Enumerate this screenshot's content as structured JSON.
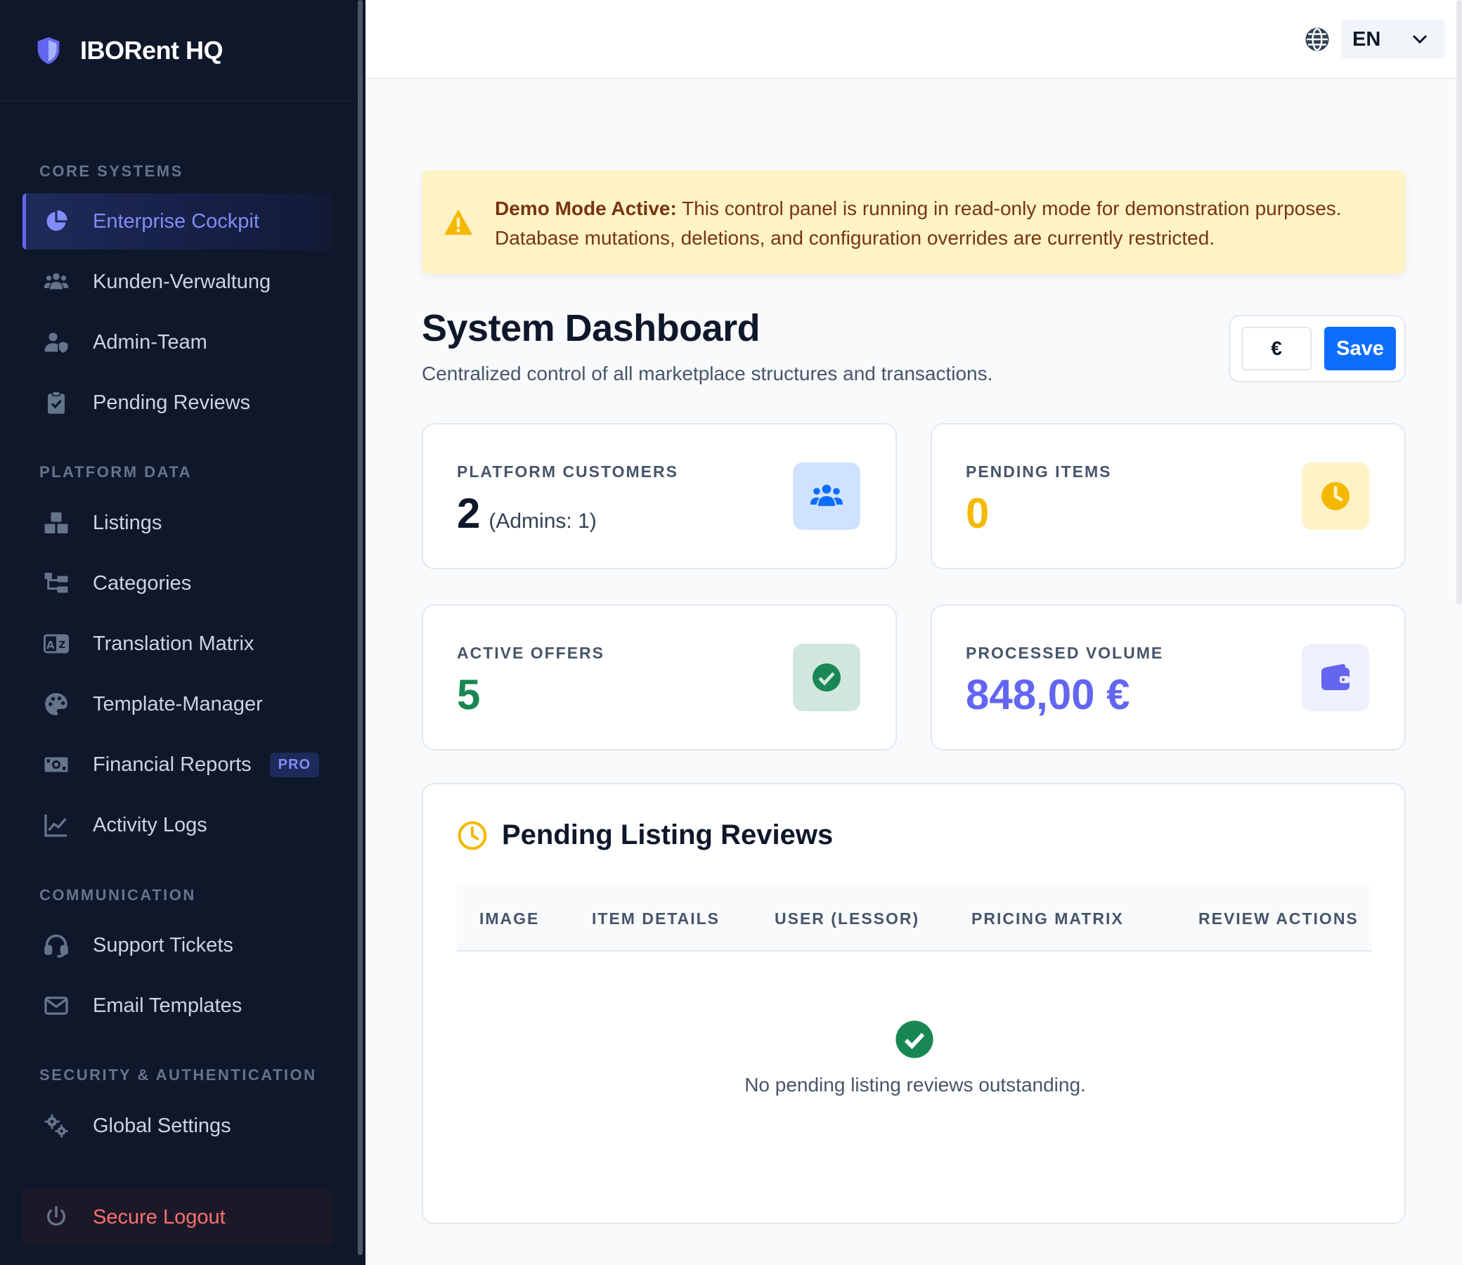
{
  "sidebar": {
    "brand": "IBORent HQ",
    "sections": [
      {
        "label": "CORE SYSTEMS"
      },
      {
        "label": "PLATFORM DATA"
      },
      {
        "label": "COMMUNICATION"
      },
      {
        "label": "SECURITY & AUTHENTICATION"
      }
    ],
    "items": [
      {
        "label": "Enterprise Cockpit",
        "icon": "pie-chart-icon",
        "active": true
      },
      {
        "label": "Kunden-Verwaltung",
        "icon": "users-icon"
      },
      {
        "label": "Admin-Team",
        "icon": "user-shield-icon"
      },
      {
        "label": "Pending Reviews",
        "icon": "clipboard-check-icon"
      },
      {
        "label": "Listings",
        "icon": "boxes-icon"
      },
      {
        "label": "Categories",
        "icon": "folder-tree-icon"
      },
      {
        "label": "Translation Matrix",
        "icon": "language-icon"
      },
      {
        "label": "Template-Manager",
        "icon": "palette-icon"
      },
      {
        "label": "Financial Reports",
        "icon": "money-icon",
        "badge": "PRO"
      },
      {
        "label": "Activity Logs",
        "icon": "line-chart-icon"
      },
      {
        "label": "Support Tickets",
        "icon": "headset-icon"
      },
      {
        "label": "Email Templates",
        "icon": "envelope-icon"
      },
      {
        "label": "Global Settings",
        "icon": "gears-icon"
      }
    ],
    "logout": "Secure Logout"
  },
  "topbar": {
    "language": "EN"
  },
  "alert": {
    "title": "Demo Mode Active:",
    "message": "This control panel is running in read-only mode for demonstration purposes. Database mutations, deletions, and configuration overrides are currently restricted."
  },
  "page": {
    "title": "System Dashboard",
    "subtitle": "Centralized control of all marketplace structures and transactions.",
    "currency_value": "€",
    "save_label": "Save"
  },
  "stats": [
    {
      "label": "PLATFORM CUSTOMERS",
      "value": "2",
      "sub": "(Admins: 1)",
      "color": "#0f172a",
      "icon": "users-icon"
    },
    {
      "label": "PENDING ITEMS",
      "value": "0",
      "color": "#f5b800",
      "icon": "clock-icon"
    },
    {
      "label": "ACTIVE OFFERS",
      "value": "5",
      "color": "#198754",
      "icon": "check-circle-icon"
    },
    {
      "label": "PROCESSED VOLUME",
      "value": "848,00 €",
      "color": "#6366f1",
      "icon": "wallet-icon"
    }
  ],
  "reviews": {
    "title": "Pending Listing Reviews",
    "columns": [
      "IMAGE",
      "ITEM DETAILS",
      "USER (LESSOR)",
      "PRICING MATRIX",
      "REVIEW ACTIONS"
    ],
    "empty_message": "No pending listing reviews outstanding."
  },
  "colors": {
    "sidebar_bg": "#0f172a",
    "accent": "#6366f1",
    "primary": "#0d6efd",
    "warning": "#f5b800",
    "success": "#198754",
    "danger": "#f87171"
  }
}
